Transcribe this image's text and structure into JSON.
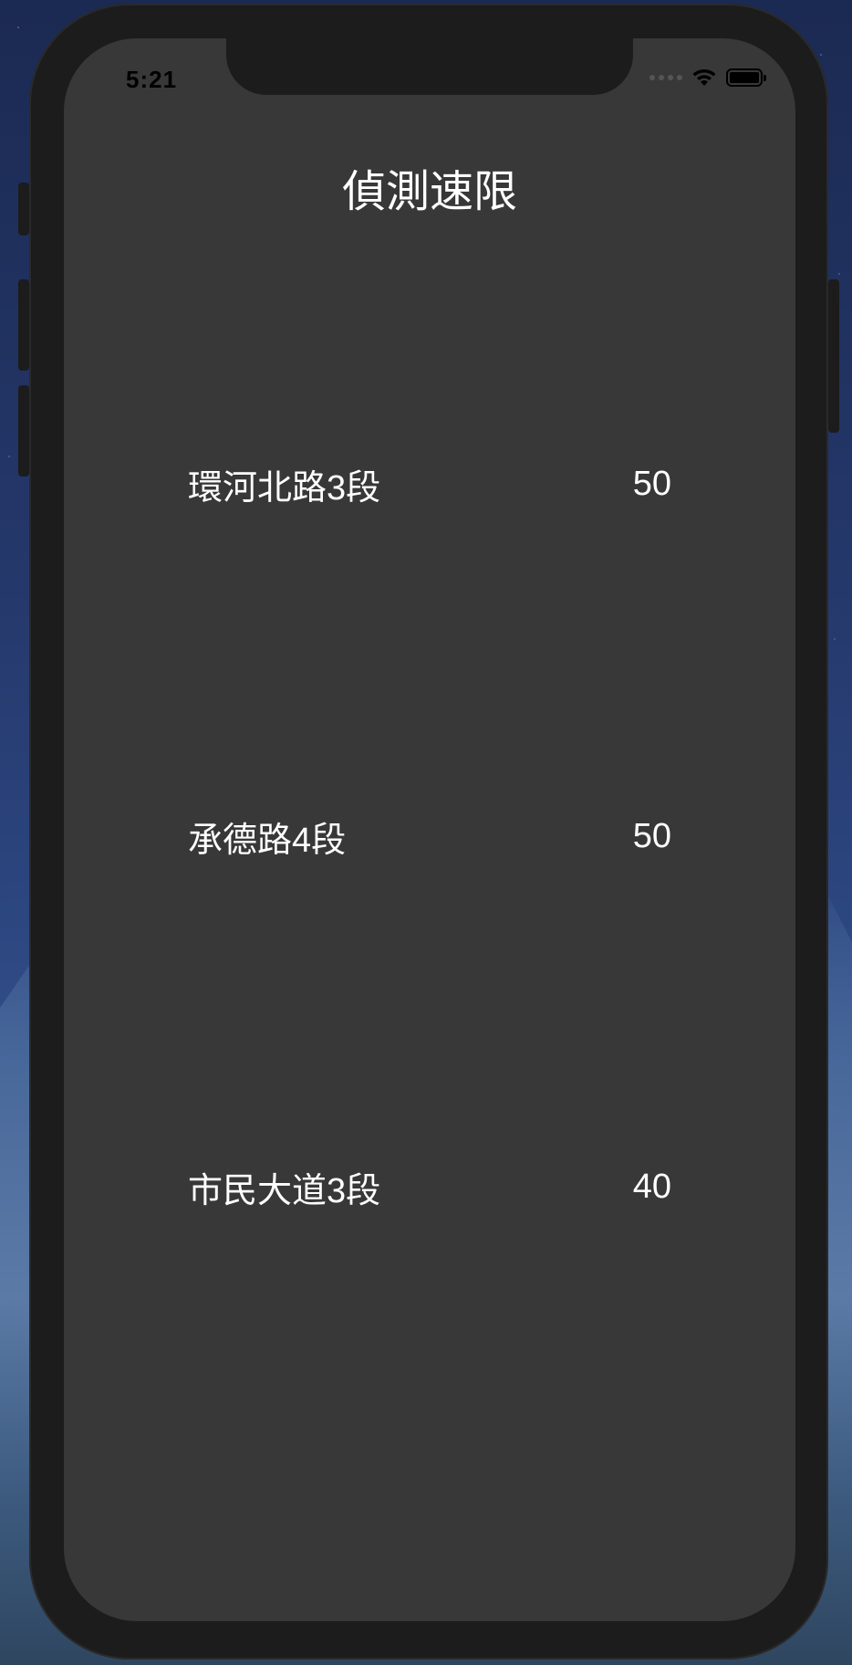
{
  "status_bar": {
    "time": "5:21"
  },
  "screen": {
    "title": "偵測速限",
    "rows": [
      {
        "road": "環河北路3段",
        "limit": "50"
      },
      {
        "road": "承德路4段",
        "limit": "50"
      },
      {
        "road": "市民大道3段",
        "limit": "40"
      }
    ]
  },
  "colors": {
    "screen_background": "#383838",
    "text": "#ffffff",
    "device_frame": "#1c1c1c"
  },
  "icons": {
    "wifi": "wifi-icon",
    "battery": "battery-icon",
    "signal": "cellular-signal-icon"
  }
}
